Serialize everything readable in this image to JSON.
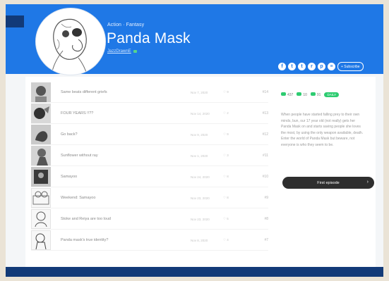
{
  "series": {
    "genres": "Action · Fantasy",
    "title": "Panda Mask",
    "author": "JazzDrawnE"
  },
  "header": {
    "subscribe_label": "+ Subscribe",
    "social_icons": [
      "facebook-icon",
      "twitter-icon",
      "tumblr-icon",
      "reddit-icon",
      "pinterest-icon",
      "rss-icon"
    ],
    "social_glyphs": [
      "f",
      "t",
      "t",
      "r",
      "p",
      "≡"
    ]
  },
  "episodes": [
    {
      "title": "Same beats different griefs",
      "date": "Nov 7, 2020",
      "likes": "♡ 9",
      "number": "#14"
    },
    {
      "title": "FOUR YEARS !!??",
      "date": "Nov 14, 2020",
      "likes": "♡ 2",
      "number": "#13"
    },
    {
      "title": "Go back?",
      "date": "Nov 9, 2020",
      "likes": "♡ 9",
      "number": "#12"
    },
    {
      "title": "Sunflower without ray",
      "date": "Nov 1, 2020",
      "likes": "♡ 3",
      "number": "#11"
    },
    {
      "title": "Samayoo",
      "date": "Nov 24, 2020",
      "likes": "♡ 8",
      "number": "#10"
    },
    {
      "title": "Weekend: Samayoo",
      "date": "Nov 23, 2020",
      "likes": "♡ 8",
      "number": "#9"
    },
    {
      "title": "Stoke and Reiya are too loud",
      "date": "Nov 23, 2020",
      "likes": "♡ 5",
      "number": "#8"
    },
    {
      "title": "Panda mask's true identity?",
      "date": "Nov 8, 2020",
      "likes": "♡ 4",
      "number": "#7"
    }
  ],
  "stats": {
    "views": "437",
    "subscribers": "10",
    "likes": "91",
    "badge": "DAILY"
  },
  "synopsis": "When people have started falling prey to their own minds, bun, our 17 year old (not really) gets her Panda Mask on and starts saving people she loves the most, by using the only weapon available, death. Enter the world of Panda Mask but beware, not everyone is who they seem to be.",
  "cta": {
    "label": "First episode",
    "arrow": "›"
  },
  "colors": {
    "brand": "#1f78e6",
    "dark_band": "#123a78",
    "badge_green": "#2ecc71"
  }
}
